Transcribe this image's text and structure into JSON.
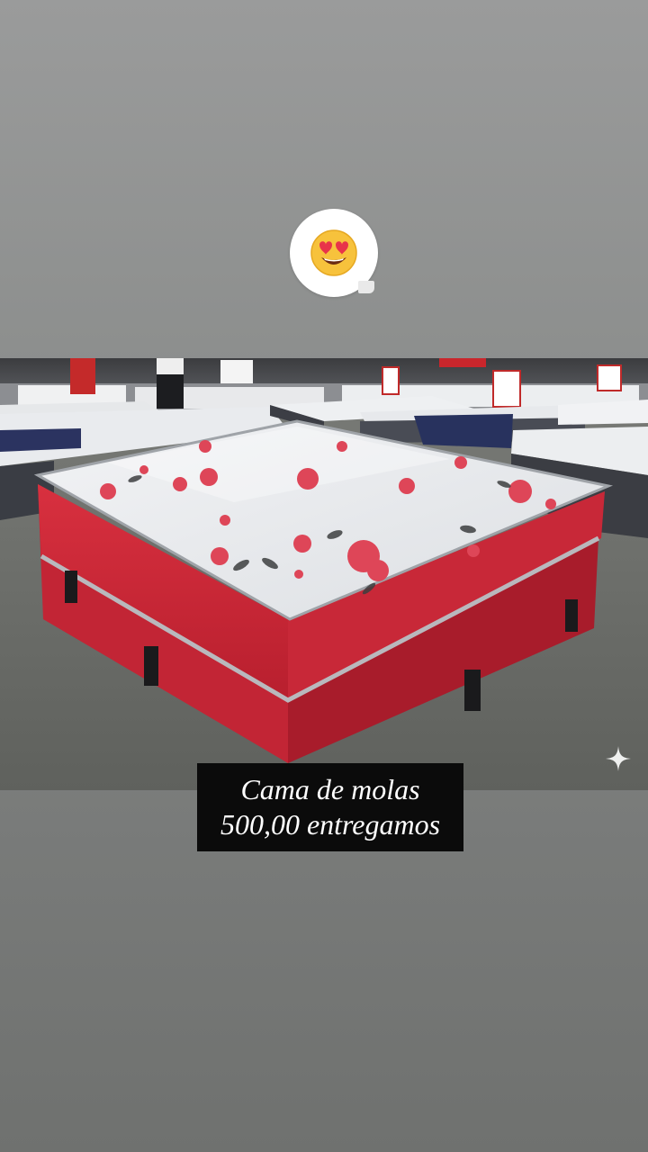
{
  "sticker": {
    "emoji": "😍",
    "icon": "heart-eyes-emoji-icon"
  },
  "caption": {
    "line1": "Cama de molas",
    "line2": "500,00 entregamos"
  },
  "photo": {
    "subject": "red-mattress-bed",
    "colors": {
      "base": "#d62b3a",
      "top": "#eceef1",
      "flowers": "#e04a5a",
      "floor": "#6d6f6c"
    }
  },
  "decor": {
    "sparkle_icon": "sparkle-icon"
  }
}
